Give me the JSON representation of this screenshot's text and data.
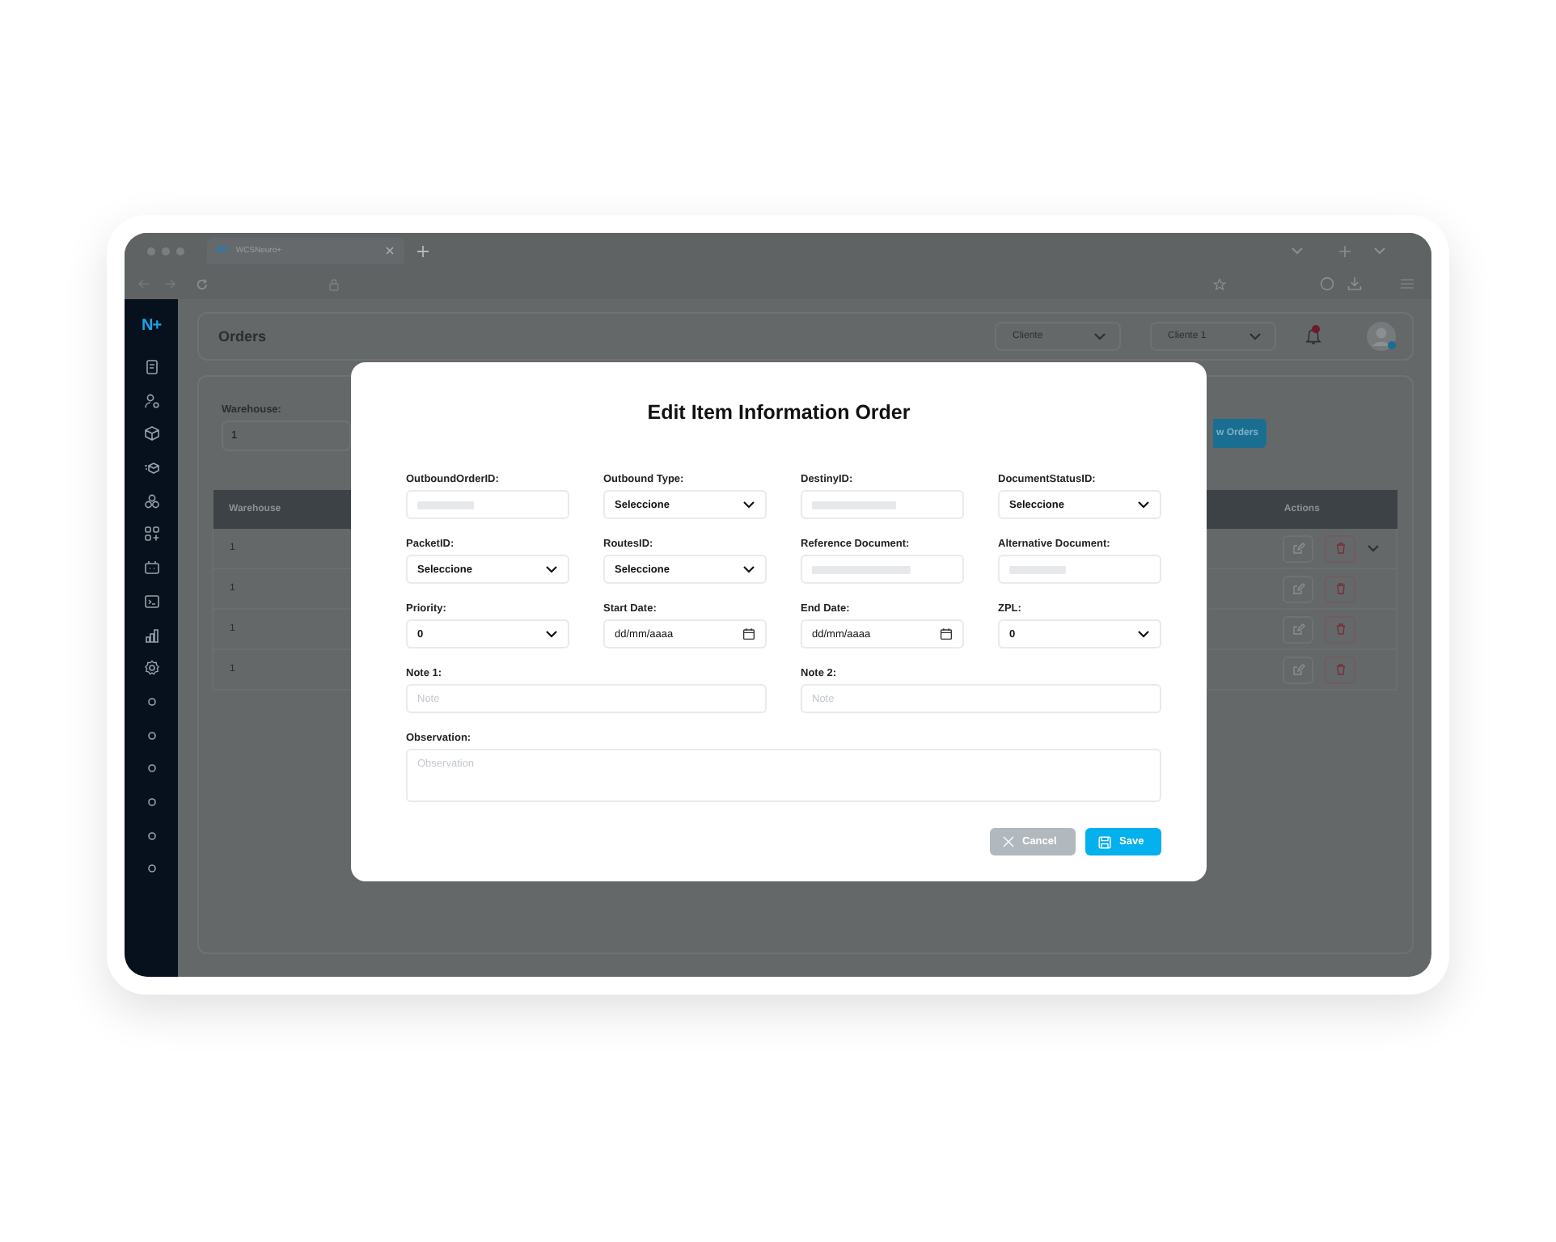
{
  "browser": {
    "tab_title": "WCSNeuro+",
    "tab_logo": "N+"
  },
  "app": {
    "logo": "N+",
    "page_title": "Orders",
    "selects": [
      "Cliente",
      "Cliente 1"
    ],
    "notifications": true
  },
  "filter": {
    "label": "Warehouse:",
    "value": "1",
    "button": "w Orders"
  },
  "table": {
    "columns": [
      "Warehouse",
      "Actions"
    ],
    "rows": [
      {
        "warehouse": "1",
        "toggle": true
      },
      {
        "warehouse": "1",
        "toggle": false
      },
      {
        "warehouse": "1",
        "toggle": false
      },
      {
        "warehouse": "1",
        "toggle": false
      }
    ]
  },
  "modal": {
    "title": "Edit Item Information Order",
    "fields": [
      {
        "label": "OutboundOrderID:",
        "kind": "masked"
      },
      {
        "label": "Outbound Type:",
        "kind": "select",
        "value": "Seleccione"
      },
      {
        "label": "DestinyID:",
        "kind": "masked"
      },
      {
        "label": "DocumentStatusID:",
        "kind": "select",
        "value": "Seleccione"
      },
      {
        "label": "PacketID:",
        "kind": "select",
        "value": "Seleccione"
      },
      {
        "label": "RoutesID:",
        "kind": "select",
        "value": "Seleccione"
      },
      {
        "label": "Reference Document:",
        "kind": "masked"
      },
      {
        "label": "Alternative Document:",
        "kind": "masked"
      },
      {
        "label": "Priority:",
        "kind": "select",
        "value": "0"
      },
      {
        "label": "Start Date:",
        "kind": "date",
        "value": "dd/mm/aaaa"
      },
      {
        "label": "End Date:",
        "kind": "date",
        "value": "dd/mm/aaaa"
      },
      {
        "label": "ZPL:",
        "kind": "select",
        "value": "0"
      },
      {
        "label": "Note 1:",
        "kind": "note",
        "placeholder": "Note"
      },
      {
        "label": "Note 2:",
        "kind": "note",
        "placeholder": "Note"
      },
      {
        "label": "Observation:",
        "kind": "textarea",
        "placeholder": "Observation"
      }
    ],
    "buttons": [
      {
        "label": "Cancel",
        "kind": "cancel"
      },
      {
        "label": "Save",
        "kind": "save"
      }
    ]
  }
}
